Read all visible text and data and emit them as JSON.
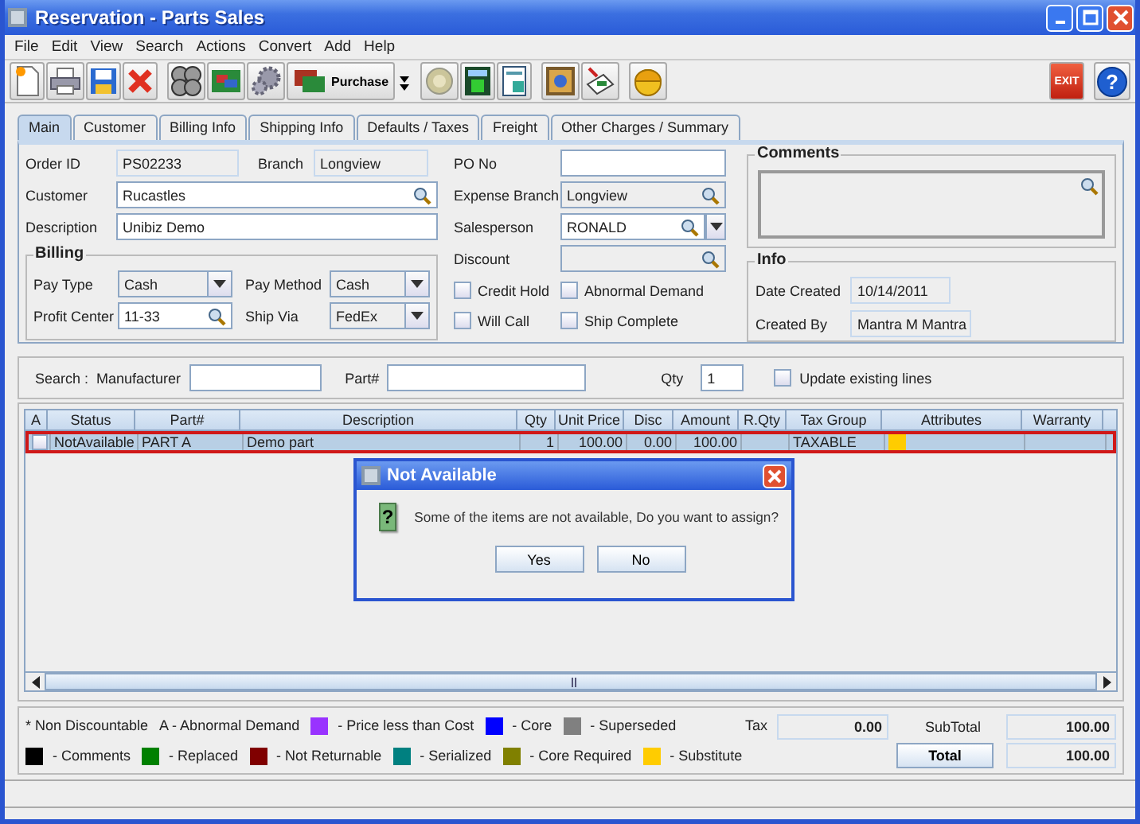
{
  "window": {
    "title": "Reservation - Parts Sales"
  },
  "menu": [
    "File",
    "Edit",
    "View",
    "Search",
    "Actions",
    "Convert",
    "Add",
    "Help"
  ],
  "toolbar": {
    "purchase_label": "Purchase",
    "exit_label": "EXIT",
    "help_label": "?"
  },
  "tabs": [
    {
      "label": "Main",
      "selected": true
    },
    {
      "label": "Customer",
      "selected": false
    },
    {
      "label": "Billing Info",
      "selected": false
    },
    {
      "label": "Shipping Info",
      "selected": false
    },
    {
      "label": "Defaults / Taxes",
      "selected": false
    },
    {
      "label": "Freight",
      "selected": false
    },
    {
      "label": "Other Charges / Summary",
      "selected": false
    }
  ],
  "main": {
    "order_id": {
      "label": "Order ID",
      "value": "PS02233"
    },
    "branch": {
      "label": "Branch",
      "value": "Longview"
    },
    "customer": {
      "label": "Customer",
      "value": "Rucastles"
    },
    "description": {
      "label": "Description",
      "value": "Unibiz Demo"
    },
    "billing": {
      "title": "Billing",
      "pay_type": {
        "label": "Pay Type",
        "value": "Cash"
      },
      "pay_method": {
        "label": "Pay Method",
        "value": "Cash"
      },
      "profit_center": {
        "label": "Profit Center",
        "value": "11-33"
      },
      "ship_via": {
        "label": "Ship Via",
        "value": "FedEx"
      }
    },
    "po_no": {
      "label": "PO No"
    },
    "expense_branch": {
      "label": "Expense Branch",
      "value": "Longview"
    },
    "salesperson": {
      "label": "Salesperson",
      "value": "RONALD"
    },
    "discount": {
      "label": "Discount"
    },
    "checkboxes": [
      {
        "label": "Credit Hold",
        "checked": false
      },
      {
        "label": "Abnormal Demand",
        "checked": false
      },
      {
        "label": "Will Call",
        "checked": false
      },
      {
        "label": "Ship Complete",
        "checked": false
      }
    ],
    "comments": {
      "title": "Comments"
    },
    "info": {
      "title": "Info",
      "date_created": {
        "label": "Date Created",
        "value": "10/14/2011"
      },
      "created_by": {
        "label": "Created By",
        "value": "Mantra M Mantra"
      }
    }
  },
  "search": {
    "label": "Search :",
    "manufacturer": "Manufacturer",
    "part": "Part#",
    "qty_label": "Qty",
    "qty_value": "1",
    "update": {
      "label": "Update existing lines",
      "checked": false
    }
  },
  "table": {
    "columns": [
      "A",
      "Status",
      "Part#",
      "Description",
      "Qty",
      "Unit Price",
      "Disc",
      "Amount",
      "R.Qty",
      "Tax Group",
      "Attributes",
      "Warranty"
    ],
    "rows": [
      {
        "selected": true,
        "a_checked": false,
        "status": "NotAvailable",
        "part": "PART A",
        "description": "Demo part",
        "qty": "1",
        "unit_price": "100.00",
        "disc": "0.00",
        "amount": "100.00",
        "tax_group": "TAXABLE",
        "color": "#ffcc00"
      }
    ]
  },
  "legend": [
    {
      "kind": "text",
      "label": "* Non Discountable"
    },
    {
      "kind": "text",
      "label": "A - Abnormal Demand"
    },
    {
      "kind": "swatch",
      "color": "#9933ff",
      "label": "- Price less than Cost"
    },
    {
      "kind": "swatch",
      "color": "#0000ff",
      "label": "- Core"
    },
    {
      "kind": "swatch",
      "color": "#808080",
      "label": "- Superseded"
    },
    {
      "kind": "swatch",
      "color": "#000000",
      "label": "- Comments"
    },
    {
      "kind": "swatch",
      "color": "#008000",
      "label": "- Replaced"
    },
    {
      "kind": "swatch",
      "color": "#800000",
      "label": "- Not Returnable"
    },
    {
      "kind": "swatch",
      "color": "#008080",
      "label": "- Serialized"
    },
    {
      "kind": "swatch",
      "color": "#808000",
      "label": "- Core Required"
    },
    {
      "kind": "swatch",
      "color": "#ffcc00",
      "label": "- Substitute"
    }
  ],
  "totals": {
    "tax_label": "Tax",
    "tax": "0.00",
    "subtotal_label": "SubTotal",
    "subtotal": "100.00",
    "total_button": "Total",
    "total": "100.00"
  },
  "dialog": {
    "title": "Not Available",
    "icon_label": "?",
    "message": "Some of the items are not available, Do you want to assign?",
    "buttons": [
      "Yes",
      "No"
    ]
  }
}
